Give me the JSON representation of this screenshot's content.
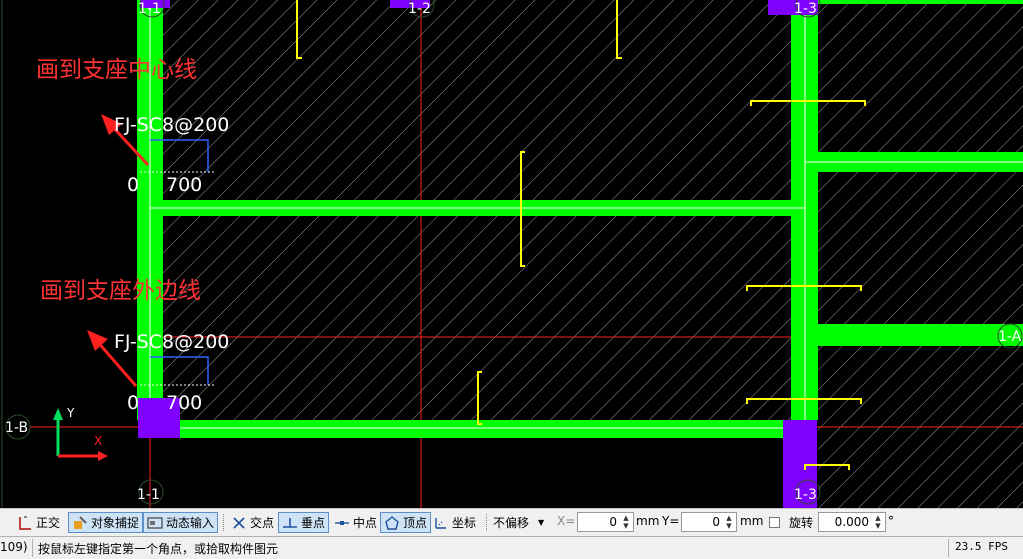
{
  "canvas": {
    "axis_labels": {
      "axis_1_1_top": "1-1",
      "axis_1_2_top": "1-2",
      "axis_1_3_top": "1-3",
      "axis_1_1_bottom": "1-1",
      "axis_1_3_bottom": "1-3",
      "axis_1_b": "1-B",
      "axis_right": "1-A"
    },
    "annotations": {
      "note_center": "画到支座中心线",
      "note_outer": "画到支座外边线"
    },
    "rebar_labels": {
      "rebar_1_name": "FJ-SC8@200",
      "rebar_1_left": "0",
      "rebar_1_right": "700",
      "rebar_2_name": "FJ-SC8@200",
      "rebar_2_left": "0",
      "rebar_2_right": "700"
    },
    "ucs": {
      "x_label": "X",
      "y_label": "Y"
    },
    "colors": {
      "beam": "#00ff00",
      "column": "#8000ff",
      "hatch": "#9a9a9a",
      "axis": "#ff2020",
      "rebar_mark": "#ffff00",
      "annotation": "#ff3333",
      "dimension": "#3060ff"
    }
  },
  "toolbar": {
    "ortho": "正交",
    "osnap": "对象捕捉",
    "dyn_input": "动态输入",
    "intersection": "交点",
    "perpendicular": "垂点",
    "midpoint": "中点",
    "vertex": "顶点",
    "coordinate": "坐标",
    "offset_mode": "不偏移",
    "x_label": "X=",
    "x_value": "0",
    "x_unit": "mm",
    "y_label": "Y=",
    "y_value": "0",
    "y_unit": "mm",
    "rotate_label": "旋转",
    "rotate_value": "0.000",
    "rotate_unit": "°"
  },
  "status": {
    "coords": "109)",
    "prompt": "按鼠标左键指定第一个角点，或拾取构件图元",
    "fps": "23.5 FPS"
  }
}
